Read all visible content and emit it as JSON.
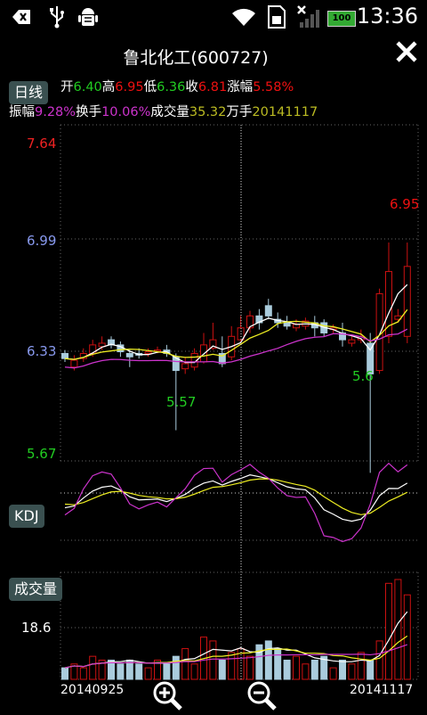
{
  "status_bar": {
    "time": "13:36",
    "battery": "100",
    "icons": [
      "back-icon",
      "usb-icon",
      "android-debug-icon",
      "wifi-icon",
      "sim-icon",
      "signal-icon",
      "battery-icon"
    ]
  },
  "title": "鲁北化工(600727)",
  "period_badge": "日线",
  "quote": {
    "open_label": "开",
    "open": "6.40",
    "high_label": "高",
    "high": "6.95",
    "low_label": "低",
    "low": "6.36",
    "close_label": "收",
    "close": "6.81",
    "change_label": "涨幅",
    "change": "5.58%",
    "amplitude_label": "振幅",
    "amplitude": "9.28%",
    "turnover_label": "换手",
    "turnover": "10.06%",
    "volume_label": "成交量",
    "volume": "35.32",
    "volume_unit": "万手",
    "date": "20141117"
  },
  "kdj_badge": "KDJ",
  "volume_badge": "成交量",
  "price_axis": [
    "7.64",
    "6.99",
    "6.33",
    "5.67"
  ],
  "volume_axis": "18.6",
  "annotations": {
    "high_peak": "6.95",
    "low1": "5.57",
    "low2": "5.6"
  },
  "dates": {
    "start": "20140925",
    "end": "20141117"
  },
  "colors": {
    "up": "#cc1111",
    "down": "#aaccdd",
    "ma1": "#ffffff",
    "ma2": "#eeee22",
    "ma3": "#cc33cc",
    "grid": "#666666"
  },
  "chart_data": {
    "type": "candlestick",
    "ylim": [
      5.67,
      7.64
    ],
    "candles": [
      [
        6.3,
        6.27,
        6.32,
        6.25
      ],
      [
        6.22,
        6.26,
        6.29,
        6.2
      ],
      [
        6.27,
        6.3,
        6.33,
        6.25
      ],
      [
        6.3,
        6.35,
        6.38,
        6.28
      ],
      [
        6.34,
        6.36,
        6.4,
        6.32
      ],
      [
        6.38,
        6.35,
        6.4,
        6.33
      ],
      [
        6.35,
        6.31,
        6.37,
        6.28
      ],
      [
        6.3,
        6.28,
        6.32,
        6.22
      ],
      [
        6.3,
        6.29,
        6.33,
        6.27
      ],
      [
        6.3,
        6.31,
        6.33,
        6.28
      ],
      [
        6.32,
        6.32,
        6.34,
        6.3
      ],
      [
        6.32,
        6.3,
        6.35,
        6.28
      ],
      [
        6.28,
        6.2,
        6.3,
        5.85
      ],
      [
        6.21,
        6.24,
        6.28,
        6.18
      ],
      [
        6.22,
        6.3,
        6.33,
        6.2
      ],
      [
        6.25,
        6.35,
        6.42,
        6.24
      ],
      [
        6.33,
        6.38,
        6.48,
        6.32
      ],
      [
        6.3,
        6.24,
        6.4,
        6.22
      ],
      [
        6.28,
        6.4,
        6.46,
        6.26
      ],
      [
        6.38,
        6.45,
        6.52,
        6.36
      ],
      [
        6.45,
        6.52,
        6.55,
        6.42
      ],
      [
        6.52,
        6.48,
        6.56,
        6.44
      ],
      [
        6.58,
        6.52,
        6.62,
        6.5
      ],
      [
        6.5,
        6.48,
        6.54,
        6.45
      ],
      [
        6.48,
        6.46,
        6.52,
        6.44
      ],
      [
        6.45,
        6.47,
        6.5,
        6.43
      ],
      [
        6.46,
        6.49,
        6.51,
        6.44
      ],
      [
        6.48,
        6.45,
        6.52,
        6.4
      ],
      [
        6.48,
        6.42,
        6.5,
        6.4
      ],
      [
        6.44,
        6.45,
        6.47,
        6.42
      ],
      [
        6.42,
        6.38,
        6.48,
        6.34
      ],
      [
        6.36,
        6.38,
        6.4,
        6.34
      ],
      [
        6.38,
        6.4,
        6.44,
        6.36
      ],
      [
        6.36,
        6.18,
        6.42,
        5.6
      ],
      [
        6.2,
        6.65,
        6.68,
        6.18
      ],
      [
        6.4,
        6.78,
        6.95,
        6.36
      ],
      [
        6.5,
        6.52,
        6.56,
        6.48
      ],
      [
        6.4,
        6.81,
        6.95,
        6.36
      ]
    ],
    "volume": [
      3,
      4,
      3,
      6,
      5,
      5,
      4,
      5,
      4,
      3,
      5,
      4,
      6,
      8,
      4,
      11,
      10,
      5,
      7,
      8,
      6,
      9,
      10,
      8,
      5,
      6,
      4,
      5,
      6,
      3,
      5,
      4,
      7,
      5,
      10,
      25,
      26,
      22
    ],
    "volume_ylim": [
      0,
      26
    ]
  }
}
